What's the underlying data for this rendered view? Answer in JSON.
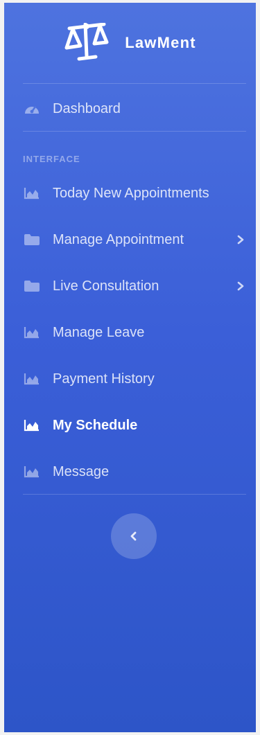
{
  "brand": {
    "name": "LawMent",
    "logo_icon": "scales-of-justice-icon"
  },
  "nav": {
    "dashboard": {
      "label": "Dashboard",
      "icon": "tachometer-icon"
    },
    "heading": "INTERFACE",
    "items": [
      {
        "label": "Today New Appointments",
        "icon": "area-chart-icon",
        "active": false,
        "has_submenu": false
      },
      {
        "label": "Manage Appointment",
        "icon": "folder-icon",
        "active": false,
        "has_submenu": true
      },
      {
        "label": "Live Consultation",
        "icon": "folder-icon",
        "active": false,
        "has_submenu": true
      },
      {
        "label": "Manage Leave",
        "icon": "area-chart-icon",
        "active": false,
        "has_submenu": false
      },
      {
        "label": "Payment History",
        "icon": "area-chart-icon",
        "active": false,
        "has_submenu": false
      },
      {
        "label": "My Schedule",
        "icon": "area-chart-icon",
        "active": true,
        "has_submenu": false
      },
      {
        "label": "Message",
        "icon": "area-chart-icon",
        "active": false,
        "has_submenu": false
      }
    ]
  },
  "sidebar_toggle": {
    "icon": "chevron-left-icon"
  },
  "colors": {
    "sidebar_top": "#4e73df",
    "sidebar_bottom": "#2d55c8",
    "text_active": "#ffffff",
    "text_muted": "rgba(255,255,255,0.82)"
  }
}
